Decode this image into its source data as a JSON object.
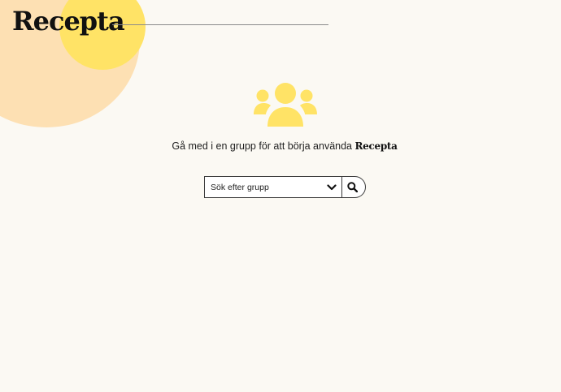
{
  "header": {
    "logo_text": "Recepta"
  },
  "empty_state": {
    "icon": "users-group-icon",
    "message_prefix": "Gå med i en grupp för att börja använda ",
    "message_brand": "Recepta"
  },
  "search": {
    "placeholder": "Sök efter grupp",
    "value": "",
    "dropdown_icon": "chevron-down-icon",
    "button_icon": "search-icon"
  },
  "colors": {
    "background": "#fbf9f3",
    "accent_yellow": "#ffe366",
    "accent_orange": "#fde0b3",
    "text": "#111111"
  }
}
